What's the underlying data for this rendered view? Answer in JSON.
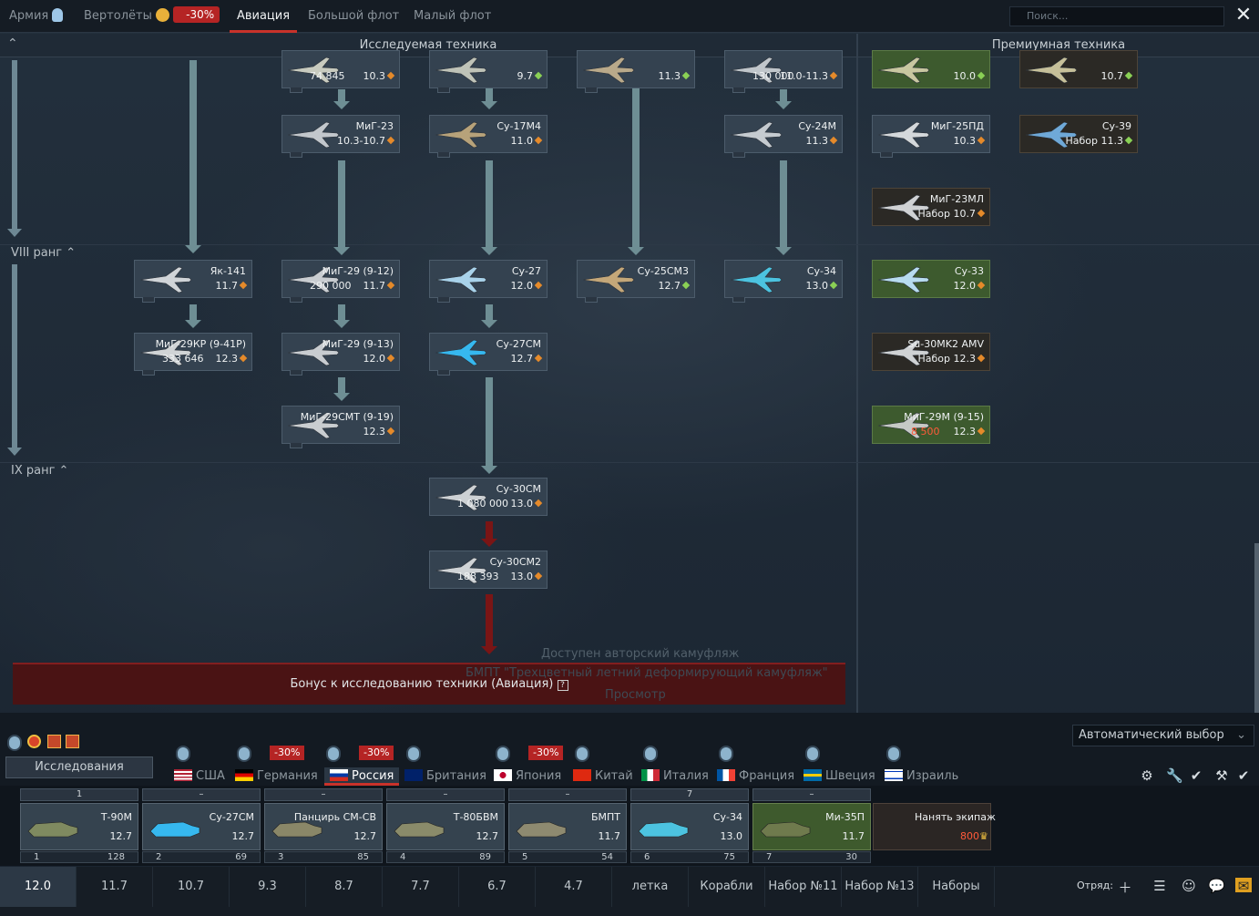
{
  "top_tabs": [
    {
      "label": "Армия"
    },
    {
      "label": "Вертолёты",
      "discount": "-30%"
    },
    {
      "label": "Авиация"
    },
    {
      "label": "Большой флот"
    },
    {
      "label": "Малый флот"
    }
  ],
  "search": {
    "placeholder": "Поиск..."
  },
  "close_glyph": "✕",
  "sections": {
    "research": "Исследуемая техника",
    "premium": "Премиумная техника"
  },
  "ranks": {
    "viii": "VIII ранг",
    "ix": "IX ранг"
  },
  "cards": [
    {
      "name": "",
      "cost": "74 845",
      "br": "10.3"
    },
    {
      "name": "",
      "cost": "",
      "br": "9.7"
    },
    {
      "name": "",
      "cost": "",
      "br": "11.3"
    },
    {
      "name": "",
      "cost": "130 000",
      "br": "11.0-11.3"
    },
    {
      "name": "",
      "cost": "",
      "br": "10.0"
    },
    {
      "name": "",
      "cost": "",
      "br": "10.7"
    },
    {
      "name": "МиГ-23",
      "cost": "",
      "br": "10.3-10.7"
    },
    {
      "name": "Су-17М4",
      "cost": "",
      "br": "11.0"
    },
    {
      "name": "Су-24М",
      "cost": "",
      "br": "11.3"
    },
    {
      "name": "МиГ-25ПД",
      "cost": "",
      "br": "10.3"
    },
    {
      "name": "Су-39",
      "cost": "",
      "br": "Набор 11.3"
    },
    {
      "name": "МиГ-23МЛ",
      "cost": "",
      "br": "Набор 10.7"
    },
    {
      "name": "Як-141",
      "cost": "",
      "br": "11.7"
    },
    {
      "name": "МиГ-29 (9-12)",
      "cost": "290 000",
      "br": "11.7"
    },
    {
      "name": "Су-27",
      "cost": "",
      "br": "12.0"
    },
    {
      "name": "Су-25СМ3",
      "cost": "",
      "br": "12.7"
    },
    {
      "name": "Су-34",
      "cost": "",
      "br": "13.0"
    },
    {
      "name": "Су-33",
      "cost": "",
      "br": "12.0"
    },
    {
      "name": "МиГ-29КР (9-41Р)",
      "cost": "333 646",
      "br": "12.3"
    },
    {
      "name": "МиГ-29 (9-13)",
      "cost": "",
      "br": "12.0"
    },
    {
      "name": "Су-27СМ",
      "cost": "",
      "br": "12.7"
    },
    {
      "name": "Su-30MK2 AMV",
      "cost": "",
      "br": "Набор 12.3"
    },
    {
      "name": "МиГ-29СМТ (9-19)",
      "cost": "",
      "br": "12.3"
    },
    {
      "name": "МиГ-29М (9-15)",
      "cost": "8 500",
      "br": "12.3"
    },
    {
      "name": "Су-30СМ",
      "cost": "1 080 000",
      "br": "13.0"
    },
    {
      "name": "Су-30СМ2",
      "cost": "188 393",
      "br": "13.0"
    }
  ],
  "bonus": {
    "text": "Бонус к исследованию техники (Авиация)",
    "ghost1": "Доступен авторский камуфляж",
    "ghost2": "БМПТ \"Трехцветный летний деформирующий камуфляж\"",
    "ghost3": "Просмотр"
  },
  "auto_select": "Автоматический выбор",
  "research_tab": "Исследования",
  "countries": [
    {
      "label": "США"
    },
    {
      "label": "Германия",
      "discount": "-30%"
    },
    {
      "label": "Россия",
      "discount": "-30%"
    },
    {
      "label": "Британия"
    },
    {
      "label": "Япония",
      "discount": "-30%"
    },
    {
      "label": "Китай"
    },
    {
      "label": "Италия"
    },
    {
      "label": "Франция"
    },
    {
      "label": "Швеция"
    },
    {
      "label": "Израиль"
    }
  ],
  "slots": [
    {
      "top": "1",
      "name": "Т-90М",
      "br": "12.7",
      "num": "1",
      "pts": "128"
    },
    {
      "top": "–",
      "name": "Су-27СМ",
      "br": "12.7",
      "num": "2",
      "pts": "69"
    },
    {
      "top": "–",
      "name": "Панцирь СМ-СВ",
      "br": "12.7",
      "num": "3",
      "pts": "85"
    },
    {
      "top": "–",
      "name": "Т-80БВМ",
      "br": "12.7",
      "num": "4",
      "pts": "89"
    },
    {
      "top": "–",
      "name": "БМПТ",
      "br": "11.7",
      "num": "5",
      "pts": "54"
    },
    {
      "top": "7",
      "name": "Су-34",
      "br": "13.0",
      "num": "6",
      "pts": "75"
    },
    {
      "top": "–",
      "name": "Ми-35П",
      "br": "11.7",
      "num": "7",
      "pts": "30"
    }
  ],
  "hire": {
    "label": "Нанять экипаж",
    "price": "800"
  },
  "presets": [
    "12.0",
    "11.7",
    "10.7",
    "9.3",
    "8.7",
    "7.7",
    "6.7",
    "4.7",
    "летка",
    "Корабли",
    "Набор №11",
    "Набор №13",
    "Наборы"
  ],
  "squad_label": "Отряд:"
}
